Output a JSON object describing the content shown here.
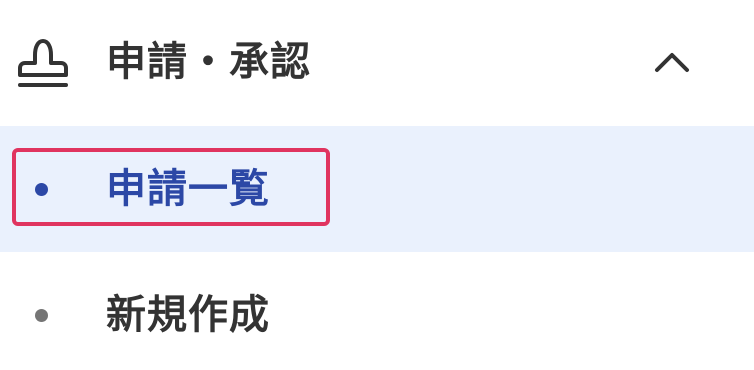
{
  "section": {
    "title": "申請・承認",
    "icon": "stamp-icon",
    "toggle_icon": "chevron-up-icon",
    "expanded": true
  },
  "items": [
    {
      "label": "申請一覧",
      "active": true
    },
    {
      "label": "新規作成",
      "active": false
    }
  ],
  "colors": {
    "active_text": "#2c48a6",
    "active_background": "#eaf1fd",
    "focus_outline": "#e0345f",
    "default_text": "#333333",
    "inactive_bullet": "#757575"
  }
}
